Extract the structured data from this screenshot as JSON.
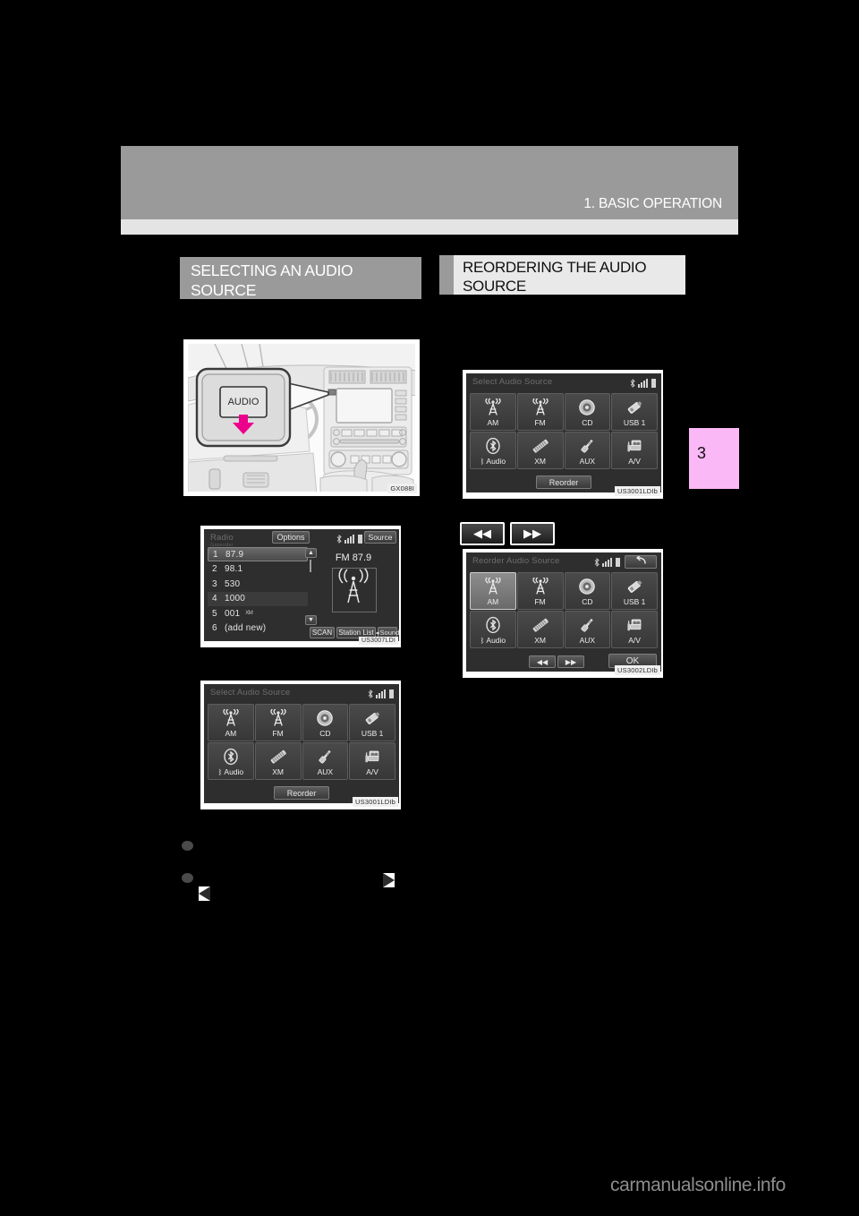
{
  "header": {
    "chapter_title": "1. BASIC OPERATION",
    "chapter_tab_number": "3"
  },
  "sections": {
    "left": {
      "heading": "SELECTING AN AUDIO\nSOURCE"
    },
    "right": {
      "heading": "REORDERING THE AUDIO\nSOURCE"
    }
  },
  "figures": {
    "dashboard": {
      "caption": "GX088I",
      "button_label": "AUDIO"
    },
    "radio_screen": {
      "caption": "US3007LDI"
    },
    "source_screen_left": {
      "caption": "US3001LDIb"
    },
    "source_screen_right": {
      "caption": "US3001LDIb"
    },
    "reorder_screen": {
      "caption": "US3002LDIb"
    }
  },
  "radio_screen": {
    "title": "Radio",
    "subtitle": "Gasender",
    "options_label": "Options",
    "source_label": "Source",
    "band_display": "FM 87.9",
    "presets": [
      {
        "number": "1",
        "value": "87.9",
        "badge": "",
        "state": "selected"
      },
      {
        "number": "2",
        "value": "98.1",
        "badge": "",
        "state": "normal"
      },
      {
        "number": "3",
        "value": "530",
        "badge": "",
        "state": "normal"
      },
      {
        "number": "4",
        "value": "1000",
        "badge": "",
        "state": "alt"
      },
      {
        "number": "5",
        "value": "001",
        "badge": "XM",
        "state": "normal"
      },
      {
        "number": "6",
        "value": "(add new)",
        "badge": "",
        "state": "normal"
      }
    ],
    "scan_label": "SCAN",
    "station_list_label": "Station List",
    "sound_label": "Sound",
    "scroll_up_icon": "arrow-up-icon",
    "scroll_down_icon": "arrow-down-icon"
  },
  "select_audio_source": {
    "title": "Select Audio Source",
    "reorder_label": "Reorder",
    "sources": [
      {
        "label": "AM",
        "icon": "radio-tower-icon"
      },
      {
        "label": "FM",
        "icon": "radio-tower-icon"
      },
      {
        "label": "CD",
        "icon": "disc-icon"
      },
      {
        "label": "USB 1",
        "icon": "usb-stick-icon"
      },
      {
        "label": "Audio",
        "icon": "bluetooth-icon"
      },
      {
        "label": "XM",
        "icon": "xm-satellite-icon"
      },
      {
        "label": "AUX",
        "icon": "aux-plug-icon"
      },
      {
        "label": "A/V",
        "icon": "camcorder-icon"
      }
    ]
  },
  "reorder_audio_source": {
    "title": "Reorder Audio Source",
    "ok_label": "OK",
    "back_icon": "return-arrow-icon",
    "prev_icon": "double-left-arrow-icon",
    "next_icon": "double-right-arrow-icon",
    "selected_index": 0,
    "sources": [
      {
        "label": "AM",
        "icon": "radio-tower-icon"
      },
      {
        "label": "FM",
        "icon": "radio-tower-icon"
      },
      {
        "label": "CD",
        "icon": "disc-icon"
      },
      {
        "label": "USB 1",
        "icon": "usb-stick-icon"
      },
      {
        "label": "Audio",
        "icon": "bluetooth-icon"
      },
      {
        "label": "XM",
        "icon": "xm-satellite-icon"
      },
      {
        "label": "AUX",
        "icon": "aux-plug-icon"
      },
      {
        "label": "A/V",
        "icon": "camcorder-icon"
      }
    ]
  },
  "page_buttons": {
    "prev_label": "◀◀",
    "next_label": "▶▶"
  },
  "watermark": "carmanualsonline.info"
}
